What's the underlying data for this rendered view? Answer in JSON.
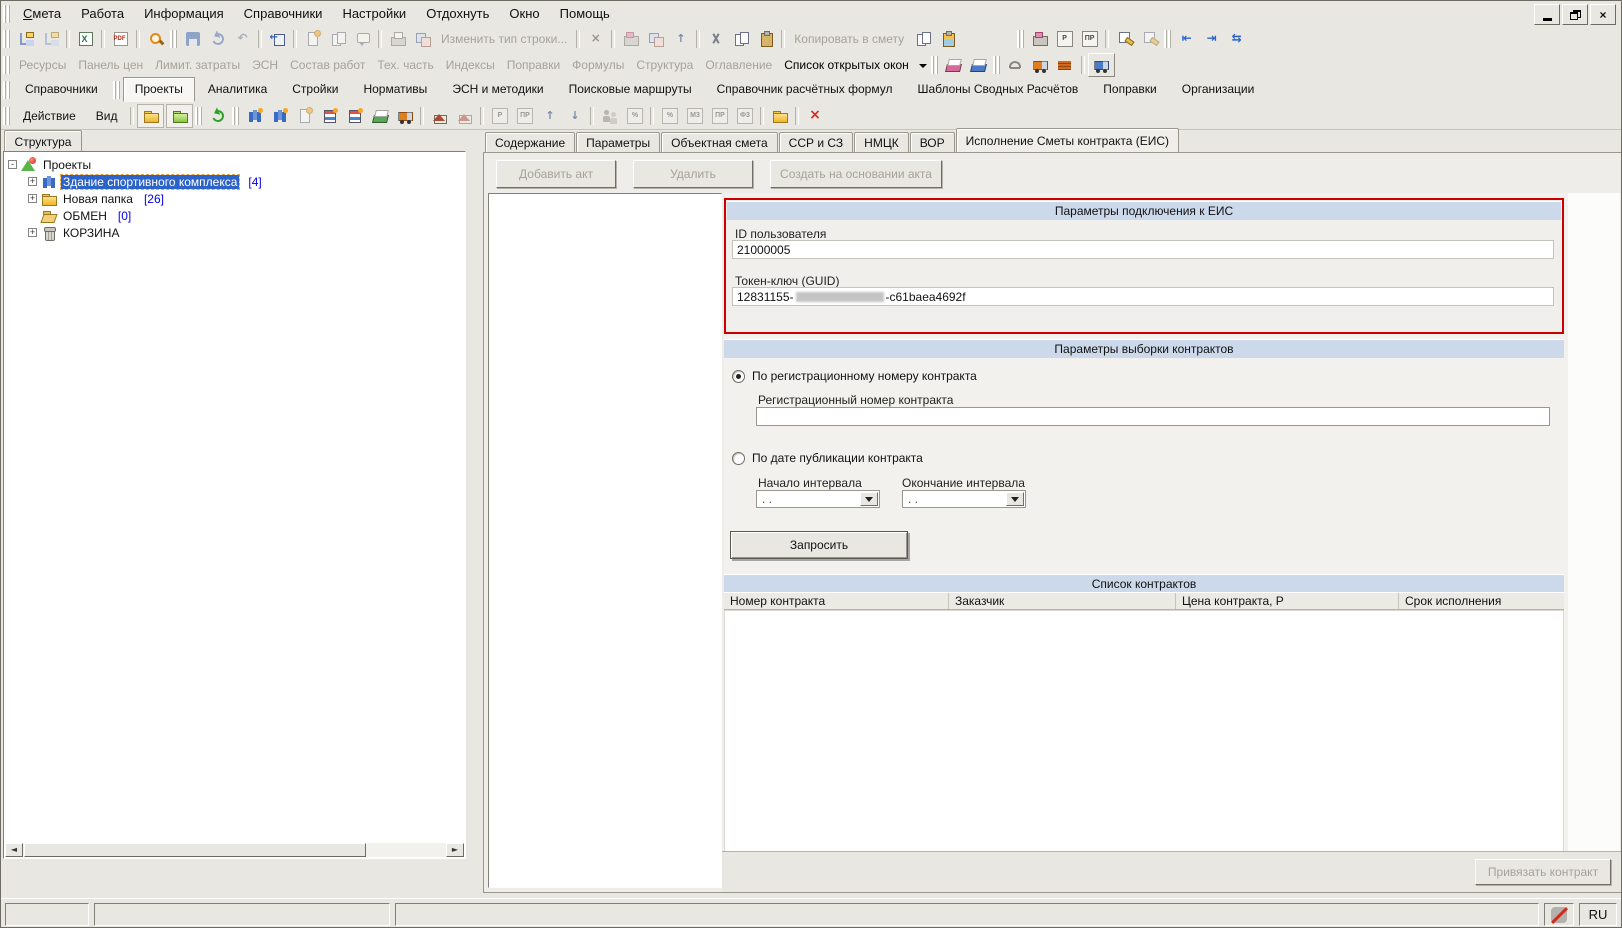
{
  "menubar": {
    "items": [
      "Смета",
      "Работа",
      "Информация",
      "Справочники",
      "Настройки",
      "Отдохнуть",
      "Окно",
      "Помощь"
    ]
  },
  "toolbar1": {
    "change_type_label": "Изменить тип строки...",
    "copy_to_estimate_label": "Копировать в смету",
    "icons": [
      "structure-tree",
      "structure-add",
      "excel-export",
      "pdf-export",
      "search",
      "save",
      "refresh",
      "undo",
      "return-to-source",
      "insert-act",
      "copy-act",
      "comment",
      "print",
      "replace-type",
      "clear",
      "cut",
      "copy",
      "paste",
      "copy-page",
      "paste-special",
      "materials-machine",
      "price-p",
      "price-pr",
      "formula-edit",
      "formula-clear",
      "indent-left",
      "indent-right",
      "indent-swap"
    ]
  },
  "toolbar2": {
    "items": [
      "Ресурсы",
      "Панель цен",
      "Лимит. затраты",
      "ЭСН",
      "Состав работ",
      "Тех. часть",
      "Индексы",
      "Поправки",
      "Формулы",
      "Структура",
      "Оглавление"
    ],
    "open_windows_label": "Список открытых окон",
    "icons": [
      "books-pink",
      "books-blue",
      "protractor",
      "truck-orange",
      "bricks",
      "truck-blue"
    ]
  },
  "main_tabs": {
    "items": [
      "Справочники",
      "Проекты",
      "Аналитика",
      "Стройки",
      "Нормативы",
      "ЭСН и методики",
      "Поисковые маршруты",
      "Справочник расчётных формул",
      "Шаблоны Сводных Расчётов",
      "Поправки",
      "Организации"
    ],
    "active": "Проекты"
  },
  "action_bar": {
    "items": [
      "Действие",
      "Вид"
    ],
    "icons": [
      "folder-up",
      "folder-collapse",
      "refresh",
      "building-add",
      "building-columns",
      "document-add",
      "estimate-add",
      "estimate-copy",
      "book-add",
      "truck-add",
      "home-add",
      "home-move",
      "price-p",
      "price-pr",
      "move-up",
      "move-down",
      "workers",
      "percent-box",
      "m3-box",
      "pr-box",
      "f3-box",
      "new-folder",
      "delete"
    ]
  },
  "left_panel": {
    "tab_label": "Структура",
    "tree": {
      "root_label": "Проекты",
      "items": [
        {
          "label": "Здание спортивного комплекса",
          "count": "[4]",
          "selected": true
        },
        {
          "label": "Новая папка",
          "count": "[26]",
          "selected": false
        },
        {
          "label": "ОБМЕН",
          "count": "[0]",
          "selected": false
        },
        {
          "label": "КОРЗИНА",
          "count": "",
          "selected": false
        }
      ]
    }
  },
  "right_panel": {
    "tabs": [
      "Содержание",
      "Параметры",
      "Объектная смета",
      "ССР и СЗ",
      "НМЦК",
      "ВОР",
      "Исполнение Сметы контракта (ЕИС)"
    ],
    "active_tab": "Исполнение Сметы контракта (ЕИС)",
    "act_buttons": [
      "Добавить акт",
      "Удалить",
      "Создать на основании акта"
    ],
    "eis": {
      "title": "Параметры подключения к ЕИС",
      "user_id_label": "ID пользователя",
      "user_id_value": "21000005",
      "token_label": "Токен-ключ (GUID)",
      "token_prefix": "12831155-",
      "token_redacted": true,
      "token_suffix": "-c61baea4692f",
      "highlight_border_color": "#cc0000"
    },
    "filter": {
      "title": "Параметры выборки контрактов",
      "by_number_label": "По регистрационному номеру контракта",
      "by_number_checked": true,
      "reg_number_label": "Регистрационный номер контракта",
      "reg_number_value": "",
      "by_date_label": "По дате публикации контракта",
      "by_date_checked": false,
      "start_label": "Начало интервала",
      "end_label": "Окончание интервала",
      "start_value": ". .",
      "end_value": ". .",
      "request_label": "Запросить"
    },
    "contracts": {
      "title": "Список контрактов",
      "columns": [
        "Номер контракта",
        "Заказчик",
        "Цена контракта, Р",
        "Срок исполнения"
      ],
      "rows": []
    },
    "bind_button_label": "Привязать контракт"
  },
  "statusbar": {
    "lang": "RU",
    "icons": [
      "sync-disabled"
    ]
  },
  "glyphs": {
    "close": "×",
    "clear_x": "×",
    "delete_x": "×",
    "expand": "+",
    "collapse": "-",
    "p": "Р",
    "pr": "ПР",
    "percent": "%",
    "m3": "М3",
    "f3": "Ф3",
    "up": "↑",
    "down": "↓",
    "undo": "↶",
    "indent_left": "⇤",
    "indent_right": "⇥",
    "indent_swap": "⇆",
    "scroll_left": "◄",
    "scroll_right": "►"
  },
  "colors": {
    "chrome": "#e9e7e2",
    "section_header": "#cbd9ea",
    "selection": "#2b63c9",
    "count_blue": "#0000e8",
    "highlight_red": "#cc0000",
    "disabled_text": "#a5a29a"
  }
}
